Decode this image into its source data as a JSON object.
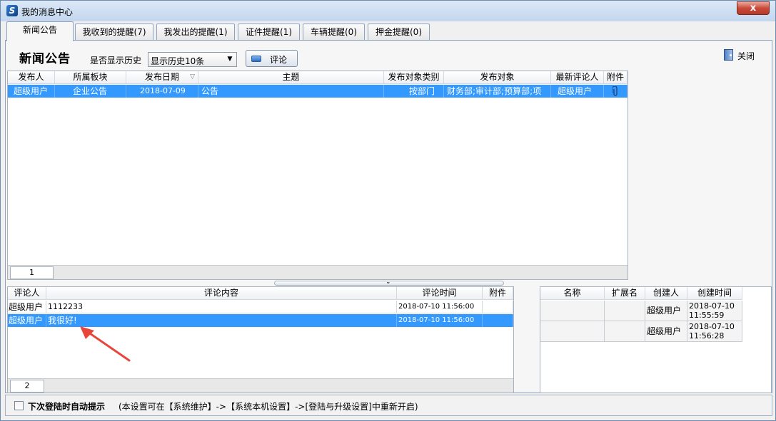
{
  "window": {
    "title": "我的消息中心",
    "app_icon": "S",
    "close_glyph": "x"
  },
  "tabs": [
    {
      "label": "新闻公告",
      "active": true
    },
    {
      "label": "我收到的提醒(7)"
    },
    {
      "label": "我发出的提醒(1)"
    },
    {
      "label": "证件提醒(1)"
    },
    {
      "label": "车辆提醒(0)"
    },
    {
      "label": "押金提醒(0)"
    }
  ],
  "toolbar": {
    "page_title": "新闻公告",
    "history_label": "是否显示历史",
    "history_select": "显示历史10条",
    "comment_button": "评论",
    "close_label": "关闭"
  },
  "news_grid": {
    "columns": [
      "发布人",
      "所属板块",
      "发布日期",
      "主题",
      "发布对象类别",
      "发布对象",
      "最新评论人",
      "附件"
    ],
    "sort_indicator": "▽",
    "rows": [
      {
        "publisher": "超级用户",
        "section": "企业公告",
        "date": "2018-07-09",
        "subject": "公告",
        "target_type": "按部门",
        "targets": "财务部;审计部;预算部;项",
        "latest_commenter": "超级用户",
        "attachment": "paperclip-icon"
      }
    ],
    "page": "1"
  },
  "comment_grid": {
    "columns": [
      "评论人",
      "评论内容",
      "评论时间",
      "附件"
    ],
    "rows": [
      {
        "commenter": "超级用户",
        "content": "1112233",
        "time": "2018-07-10 11:56:00",
        "selected": false
      },
      {
        "commenter": "超级用户",
        "content": "我很好!",
        "time": "2018-07-10 11:56:00",
        "selected": true
      }
    ],
    "page": "2"
  },
  "file_grid": {
    "columns": [
      "名称",
      "扩展名",
      "创建人",
      "创建时间"
    ],
    "rows": [
      {
        "name": "",
        "ext": "",
        "creator": "超级用户",
        "created": [
          "2018-07-10",
          "11:55:59"
        ]
      },
      {
        "name": "",
        "ext": "",
        "creator": "超级用户",
        "created": [
          "2018-07-10",
          "11:56:28"
        ]
      }
    ]
  },
  "footer": {
    "checkbox_label": "下次登陆时自动提示",
    "note": "(本设置可在【系统维护】->【系统本机设置】->[登陆与升级设置]中重新开启)"
  },
  "colors": {
    "selection": "#3399ff",
    "annotation_arrow": "#e8463a"
  }
}
